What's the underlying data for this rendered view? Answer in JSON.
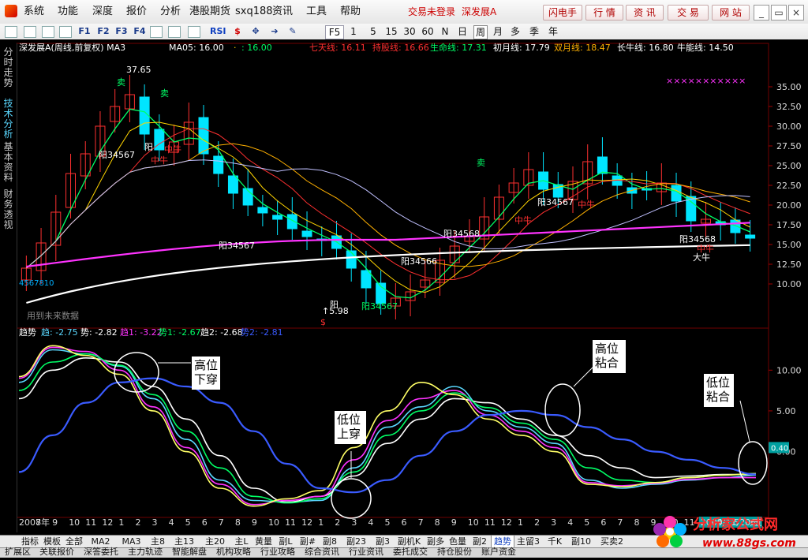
{
  "menubar": {
    "items": [
      "系统",
      "功能",
      "深度",
      "报价",
      "分析",
      "港股期货",
      "sxq188",
      "资讯",
      "工具",
      "帮助"
    ],
    "status_text": "交易未登录",
    "stock_title": "深发展A",
    "buttons": [
      "闪电手",
      "行 情",
      "资 讯",
      "交 易",
      "网 站"
    ],
    "window_controls": [
      "_",
      "▭",
      "×"
    ]
  },
  "toolbar": {
    "period_labels": [
      "F5",
      "1",
      "5",
      "15",
      "30",
      "60",
      "N",
      "日",
      "周",
      "月",
      "多",
      "季",
      "年"
    ],
    "active_period": "周",
    "icons": [
      "back-icon",
      "grid-icon",
      "line-chart-icon",
      "split-icon",
      "f1-icon",
      "f2-icon",
      "f3-icon",
      "f4-icon",
      "tile-icon",
      "settings-icon",
      "draw-icon",
      "rsi-icon",
      "s-icon",
      "move-icon",
      "arrow-icon",
      "pencil-icon"
    ]
  },
  "side_tabs": [
    "分时走势",
    "技术分析",
    "基本资料",
    "财务透视"
  ],
  "price_panel": {
    "title": "深发展A(周线,前复权) MA3",
    "ma_labels": [
      {
        "text": "MA05: 16.00",
        "color": "#ffffff"
      },
      {
        "text": "·",
        "color": "#ffd400"
      },
      {
        "text": ": 16.00",
        "color": "#00ff66"
      }
    ],
    "lines": [
      {
        "text": "七天线: 16.11",
        "color": "#ff3030"
      },
      {
        "text": "持股线: 16.66",
        "color": "#ff3030"
      },
      {
        "text": "生命线: 17.31",
        "color": "#00ff66"
      },
      {
        "text": "初月线: 17.79",
        "color": "#ffffff"
      },
      {
        "text": "双月线: 18.47",
        "color": "#ffb000"
      },
      {
        "text": "长牛线: 16.80",
        "color": "#ffffff"
      },
      {
        "text": "牛能线: 14.50",
        "color": "#ffffff"
      }
    ],
    "price_ticks": [
      "35.00",
      "32.50",
      "30.00",
      "27.50",
      "25.00",
      "22.50",
      "20.00",
      "17.50",
      "15.00",
      "12.50",
      "10.00"
    ],
    "peak_label": "37.65",
    "low_label": "↑5.98",
    "left_label": "4567810",
    "note": "用到未来数据",
    "markers": [
      {
        "text": "卖",
        "color": "#00ff66"
      },
      {
        "text": "卖",
        "color": "#00ff66"
      },
      {
        "text": "卖",
        "color": "#00ff66"
      },
      {
        "text": "阳",
        "color": "#ffffff"
      },
      {
        "text": "阳34567",
        "color": "#ffffff"
      },
      {
        "text": "阳34567",
        "color": "#ffffff"
      },
      {
        "text": "阳34568",
        "color": "#ffffff"
      },
      {
        "text": "阳34566",
        "color": "#ffffff"
      },
      {
        "text": "阳34567",
        "color": "#00ff66"
      },
      {
        "text": "阳34567",
        "color": "#ffffff"
      },
      {
        "text": "阳34568",
        "color": "#ffffff"
      },
      {
        "text": "阳",
        "color": "#ffffff"
      },
      {
        "text": "中牛",
        "color": "#ff3030"
      },
      {
        "text": "中牛",
        "color": "#ff3030"
      },
      {
        "text": "中牛",
        "color": "#ff3030"
      },
      {
        "text": "中牛",
        "color": "#ff3030"
      },
      {
        "text": "大牛",
        "color": "#ffffff"
      },
      {
        "text": "中牛",
        "color": "#ff3030"
      },
      {
        "text": "$",
        "color": "#ff3030"
      },
      {
        "text": "×××××××××××",
        "color": "#ff33ff"
      }
    ]
  },
  "indicator_panel": {
    "title": "趋势",
    "values": [
      {
        "text": "趋: -2.75",
        "color": "#5ad8ff"
      },
      {
        "text": "势: -2.82",
        "color": "#ffffff"
      },
      {
        "text": "趋1: -3.22",
        "color": "#ff33ff"
      },
      {
        "text": "势1: -2.67",
        "color": "#00ff66"
      },
      {
        "text": "趋2: -2.68",
        "color": "#ffffff"
      },
      {
        "text": "势2: -2.81",
        "color": "#3a5bff"
      }
    ],
    "ticks": [
      "10.00",
      "5.00",
      "0.00"
    ],
    "current_value": "0.40",
    "annotations": [
      "高位下穿",
      "低位上穿",
      "高位粘合",
      "低位粘合"
    ]
  },
  "time_axis": {
    "labels": [
      "2007年",
      "8",
      "9",
      "10",
      "11",
      "12",
      "1",
      "2",
      "3",
      "4",
      "5",
      "6",
      "7",
      "8",
      "9",
      "10",
      "11",
      "12",
      "1",
      "2",
      "3",
      "4",
      "5",
      "6",
      "7",
      "8",
      "9",
      "10",
      "11",
      "12",
      "1",
      "2",
      "3",
      "4",
      "5",
      "6",
      "7",
      "8",
      "9",
      "10",
      "11",
      "2009/11/20/五",
      "4",
      "5",
      "6"
    ],
    "highlight": "2009/11/20/五"
  },
  "bottom_tabs": {
    "items": [
      "指标",
      "模板",
      "全部",
      "MA2",
      "MA3",
      "主8",
      "主13",
      "主20",
      "主L",
      "黄量",
      "副L",
      "副#",
      "副8",
      "副23",
      "副3",
      "副机K",
      "副多",
      "色量",
      "副2",
      "趋势",
      "主留3",
      "千K",
      "副10",
      "买卖2"
    ],
    "active": "趋势"
  },
  "status_bar": {
    "items": [
      "扩展区",
      "关联报价",
      "深答委托",
      "主力轨迹",
      "智能解盘",
      "机构攻略",
      "行业攻略",
      "综合资讯",
      "行业资讯",
      "委托成交",
      "持仓股份",
      "账户资金"
    ]
  },
  "watermark": {
    "title": "分析家公式网",
    "url": "www.88gs.com"
  },
  "colors": {
    "bg": "#000000",
    "up": "#ff3030",
    "down": "#00e5ff",
    "accent_magenta": "#ff33ff",
    "accent_green": "#00ff66",
    "accent_white": "#ffffff"
  },
  "chart_data": {
    "type": "line",
    "price": {
      "ylim": [
        5,
        38
      ],
      "ticks": [
        10,
        12.5,
        15,
        17.5,
        20,
        22.5,
        25,
        27.5,
        30,
        32.5,
        35
      ],
      "candles_close": [
        12.0,
        15.2,
        19.1,
        24.0,
        26.5,
        30.0,
        32.5,
        34.0,
        29.0,
        27.0,
        28.0,
        30.5,
        26.5,
        24.0,
        21.5,
        20.0,
        19.0,
        18.2,
        17.0,
        16.0,
        15.5,
        14.5,
        12.0,
        9.5,
        7.5,
        8.2,
        9.0,
        10.5,
        13.0,
        14.8,
        16.0,
        18.5,
        21.0,
        22.8,
        24.5,
        22.0,
        21.0,
        23.0,
        25.5,
        24.0,
        22.5,
        21.5,
        22.0,
        22.8,
        20.5,
        18.0,
        18.2,
        17.5,
        16.5,
        15.8
      ]
    },
    "indicator": {
      "ylim": [
        -7.5,
        14
      ],
      "series": [
        {
          "name": "趋",
          "color": "#5ad8ff",
          "values": [
            8.5,
            12.5,
            12.0,
            10.5,
            6.5,
            1.5,
            -3.5,
            -6.0,
            -6.2,
            -6.0,
            -2.0,
            3.0,
            5.5,
            8.0,
            5.0,
            3.0,
            1.0,
            -3.5,
            -4.5,
            -4.0,
            -3.5,
            -3.2,
            -2.9
          ]
        },
        {
          "name": "势",
          "color": "#ffffff",
          "values": [
            6.5,
            10.0,
            11.5,
            11.0,
            8.0,
            4.0,
            -0.5,
            -4.5,
            -6.2,
            -5.5,
            -3.0,
            1.0,
            4.0,
            6.5,
            6.0,
            4.0,
            2.0,
            -0.5,
            -2.0,
            -3.2,
            -3.0,
            -2.8,
            -2.8
          ]
        },
        {
          "name": "趋1",
          "color": "#ff33ff",
          "values": [
            9.0,
            12.8,
            12.3,
            10.0,
            5.5,
            0.5,
            -4.0,
            -6.5,
            -6.0,
            -5.5,
            -1.0,
            3.8,
            6.5,
            7.5,
            4.5,
            2.5,
            0.5,
            -3.8,
            -4.2,
            -3.9,
            -3.4,
            -3.2,
            -3.2
          ]
        },
        {
          "name": "势1",
          "color": "#00ff66",
          "values": [
            7.5,
            11.0,
            12.0,
            10.6,
            7.0,
            2.5,
            -2.0,
            -5.5,
            -6.3,
            -5.8,
            -2.5,
            2.0,
            5.0,
            7.2,
            5.4,
            3.5,
            1.5,
            -2.0,
            -3.5,
            -3.8,
            -3.2,
            -2.9,
            -2.7
          ]
        },
        {
          "name": "趋2",
          "color": "#ffff66",
          "values": [
            9.2,
            13.0,
            11.8,
            9.5,
            5.0,
            0.0,
            -4.5,
            -6.7,
            -5.8,
            -4.8,
            0.5,
            5.0,
            8.5,
            7.0,
            4.0,
            2.0,
            0.0,
            -4.0,
            -4.3,
            -3.8,
            -3.2,
            -2.9,
            -2.7
          ]
        },
        {
          "name": "势2",
          "color": "#3a5bff",
          "values": [
            -2.5,
            2.0,
            6.0,
            8.5,
            9.0,
            8.0,
            6.0,
            2.5,
            -1.5,
            -4.5,
            -5.0,
            -3.5,
            -0.5,
            2.5,
            4.5,
            5.0,
            4.5,
            3.0,
            1.5,
            0.0,
            -1.0,
            -2.0,
            -2.8
          ]
        }
      ]
    }
  }
}
